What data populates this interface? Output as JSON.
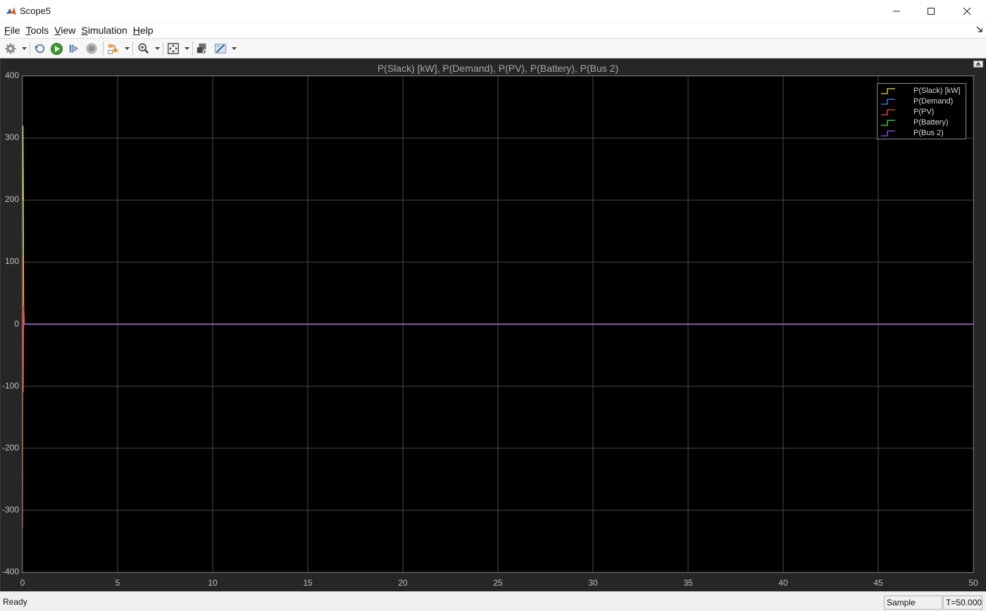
{
  "window": {
    "title": "Scope5"
  },
  "menu": [
    {
      "underline": "F",
      "rest": "ile"
    },
    {
      "underline": "T",
      "rest": "ools"
    },
    {
      "underline": "V",
      "rest": "iew"
    },
    {
      "underline": "S",
      "rest": "imulation"
    },
    {
      "underline": "H",
      "rest": "elp"
    }
  ],
  "toolbar": {
    "icons": [
      "gear-icon",
      "step-back-icon",
      "run-icon",
      "step-forward-icon",
      "stop-icon",
      "highlight-icon",
      "zoom-icon",
      "fit-icon",
      "restore-icon",
      "measure-icon"
    ]
  },
  "chart_data": {
    "type": "line",
    "title": "P(Slack) [kW], P(Demand), P(PV), P(Battery), P(Bus 2)",
    "xlim": [
      0,
      50
    ],
    "ylim": [
      -400,
      400
    ],
    "xticks": [
      "0",
      "5",
      "10",
      "15",
      "20",
      "25",
      "30",
      "35",
      "40",
      "45",
      "50"
    ],
    "yticks": [
      "400",
      "300",
      "200",
      "100",
      "0",
      "-100",
      "-200",
      "-300",
      "-400"
    ],
    "grid": true,
    "legend_position": "top-right",
    "series": [
      {
        "name": "P(Slack) [kW]",
        "color": "#e6e64c",
        "x": [
          0,
          0.02,
          0.04,
          0.06,
          0.1,
          50
        ],
        "y": [
          200,
          320,
          210,
          0,
          0,
          0
        ]
      },
      {
        "name": "P(Demand)",
        "color": "#3c8ce6",
        "x": [
          0,
          0.1,
          50
        ],
        "y": [
          0,
          0,
          0
        ]
      },
      {
        "name": "P(PV)",
        "color": "#e6553c",
        "x": [
          0,
          0.02,
          0.04,
          0.06,
          0.1,
          50
        ],
        "y": [
          -330,
          110,
          -110,
          30,
          0,
          0
        ]
      },
      {
        "name": "P(Battery)",
        "color": "#4cd84c",
        "x": [
          0,
          0.1,
          50
        ],
        "y": [
          0,
          0,
          0
        ]
      },
      {
        "name": "P(Bus 2)",
        "color": "#a54ce6",
        "x": [
          0,
          50
        ],
        "y": [
          0,
          0
        ]
      }
    ]
  },
  "status": {
    "left": "Ready",
    "mode": "Sample based",
    "time": "T=50.000"
  }
}
